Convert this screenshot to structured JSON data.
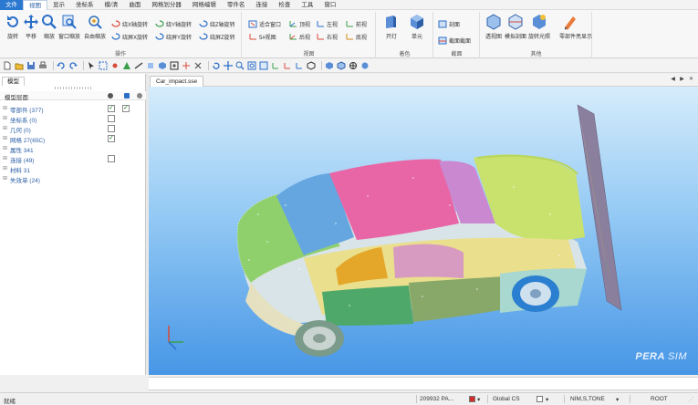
{
  "menubar": {
    "items": [
      "文件",
      "视图",
      "显示",
      "坐标系",
      "模/清",
      "曲面",
      "网格划分器",
      "网格编辑",
      "零件名",
      "连接",
      "检查",
      "工具",
      "窗口"
    ]
  },
  "ribbon": {
    "groups": [
      {
        "label": "操作",
        "buttons": [
          "旋转",
          "平移",
          "缩放",
          "窗口缩放",
          "自由缩放"
        ],
        "small": [
          "绕X轴旋转",
          "绕屏X旋转",
          "绕Y轴旋转",
          "绕屏Y旋转",
          "绕Z轴旋转",
          "绕屏Z旋转"
        ]
      },
      {
        "label": "视图",
        "small": [
          "适合窗口",
          "5#视图",
          "顶视",
          "后视",
          "左视",
          "右视",
          "前视",
          "底视"
        ]
      },
      {
        "label": "着色",
        "buttons": [
          "开灯",
          "单元"
        ]
      },
      {
        "label": "截面",
        "small": [
          "剖面",
          "截面截面"
        ]
      },
      {
        "label": "其他",
        "buttons": [
          "透视图",
          "模拟剖面",
          "旋转光照",
          "零部件亮显示"
        ]
      }
    ]
  },
  "left_panel": {
    "tab": "模型",
    "tree_header": "模型层面",
    "rows": [
      {
        "label": "零部件 (377)",
        "checked": true,
        "second_checked": true
      },
      {
        "label": "坐标系 (0)",
        "checked": false,
        "second_checked": false
      },
      {
        "label": "几何 (0)",
        "checked": false,
        "second_checked": false
      },
      {
        "label": "网格 27(65C)",
        "checked": true,
        "second_checked": false
      },
      {
        "label": "属性 341",
        "checked": null,
        "second_checked": null
      },
      {
        "label": "连接 (49)",
        "checked": false,
        "second_checked": false
      },
      {
        "label": "材料 31",
        "checked": null,
        "second_checked": null
      },
      {
        "label": "失效单 (24)",
        "checked": null,
        "second_checked": null
      }
    ]
  },
  "doc_tab": {
    "label": "Car_impact.sse",
    "controls": [
      "◀",
      "▶",
      "✕"
    ]
  },
  "viewport": {
    "brand_main": "PERA",
    "brand_sub": "SIM"
  },
  "status": {
    "left": "就绪",
    "coord": "209932 PA...",
    "system": "Global CS",
    "mode": "NIM,S,TONE",
    "root": "ROOT"
  },
  "colors": {
    "accent": "#2b78d0",
    "viewport_top": "#d6ecfb",
    "viewport_bottom": "#4796e6",
    "car_roof": "#e966a6",
    "car_hood": "#66a6e0",
    "car_side": "#8fd06d",
    "car_trunk": "#c9e26e"
  }
}
